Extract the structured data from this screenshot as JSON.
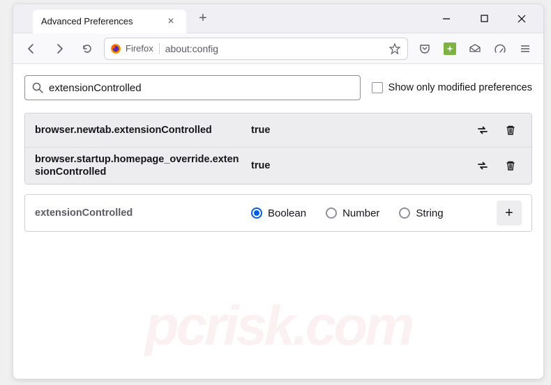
{
  "titlebar": {
    "tab_title": "Advanced Preferences"
  },
  "navbar": {
    "identity_label": "Firefox",
    "url": "about:config"
  },
  "search": {
    "value": "extensionControlled",
    "checkbox_label": "Show only modified preferences"
  },
  "prefs": [
    {
      "name": "browser.newtab.extensionControlled",
      "value": "true"
    },
    {
      "name": "browser.startup.homepage_override.extensionControlled",
      "value": "true"
    }
  ],
  "new_pref": {
    "name": "extensionControlled",
    "types": [
      "Boolean",
      "Number",
      "String"
    ],
    "selected": "Boolean"
  },
  "watermark": "pcrisk.com"
}
